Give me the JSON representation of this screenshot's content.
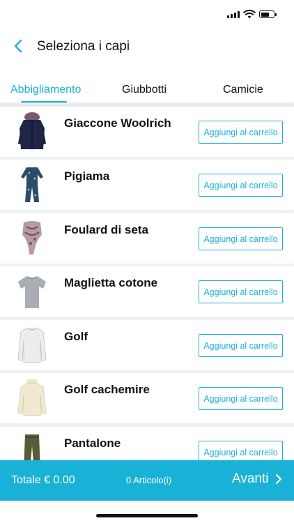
{
  "colors": {
    "accent": "#1ab1d6",
    "text": "#111111",
    "separator": "#eef0f2"
  },
  "status_bar": {
    "battery_level": 0.7,
    "signal_bars": 4
  },
  "header": {
    "title": "Seleziona i capi",
    "back_icon": "chevron-left-icon"
  },
  "tabs": [
    {
      "label": "Abbigliamento",
      "active": true
    },
    {
      "label": "Giubbotti",
      "active": false
    },
    {
      "label": "Camicie",
      "active": false
    }
  ],
  "items": [
    {
      "name": "Giaccone Woolrich",
      "button": "Aggiungi al carrello",
      "icon": "jacket-icon"
    },
    {
      "name": "Pigiama",
      "button": "Aggiungi al carrello",
      "icon": "pajamas-icon"
    },
    {
      "name": "Foulard di seta",
      "button": "Aggiungi al carrello",
      "icon": "scarf-icon"
    },
    {
      "name": "Maglietta cotone",
      "button": "Aggiungi al carrello",
      "icon": "tshirt-icon"
    },
    {
      "name": "Golf",
      "button": "Aggiungi al carrello",
      "icon": "sweater-icon"
    },
    {
      "name": "Golf cachemire",
      "button": "Aggiungi al carrello",
      "icon": "cashmere-sweater-icon"
    },
    {
      "name": "Pantalone",
      "button": "Aggiungi al carrello",
      "icon": "trousers-icon"
    }
  ],
  "footer": {
    "total": "Totale € 0.00",
    "count": "0 Articolo(i)",
    "next": "Avanti"
  }
}
